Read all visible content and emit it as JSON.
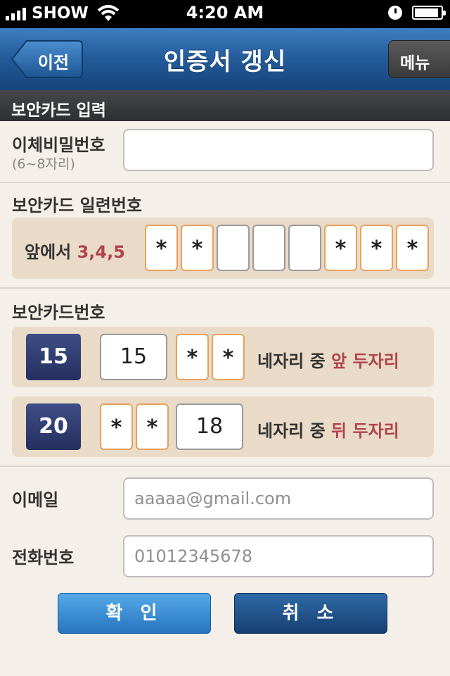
{
  "status_bar": {
    "carrier": "SHOW",
    "time": "4:20 AM"
  },
  "nav": {
    "back_label": "이전",
    "title": "인증서 갱신",
    "menu_label": "메뉴"
  },
  "section_title": "보안카드 입력",
  "transfer_pw": {
    "label": "이체비밀번호",
    "sublabel": "(6~8자리)",
    "value": ""
  },
  "serial": {
    "label": "보안카드 일련번호",
    "prefix": "앞에서 ",
    "highlight": "3,4,5",
    "cells": [
      "*",
      "*",
      "",
      "",
      "",
      "*",
      "*",
      "*"
    ]
  },
  "card_number": {
    "label": "보안카드번호",
    "rows": [
      {
        "index": "15",
        "hint_prefix": "네자리 중 ",
        "hint_highlight": "앞 두자리",
        "boxes": [
          "15",
          "*",
          "*"
        ]
      },
      {
        "index": "20",
        "hint_prefix": "네자리 중 ",
        "hint_highlight": "뒤 두자리",
        "boxes": [
          "*",
          "*",
          "18"
        ]
      }
    ]
  },
  "email": {
    "label": "이메일",
    "placeholder": "aaaaa@gmail.com"
  },
  "phone": {
    "label": "전화번호",
    "placeholder": "01012345678"
  },
  "buttons": {
    "confirm": "확 인",
    "cancel": "취 소"
  },
  "colors": {
    "highlight": "#b0444c",
    "nav_blue": "#245d9d",
    "star_border": "#e7a15b",
    "badge": "#2e3a6e"
  }
}
